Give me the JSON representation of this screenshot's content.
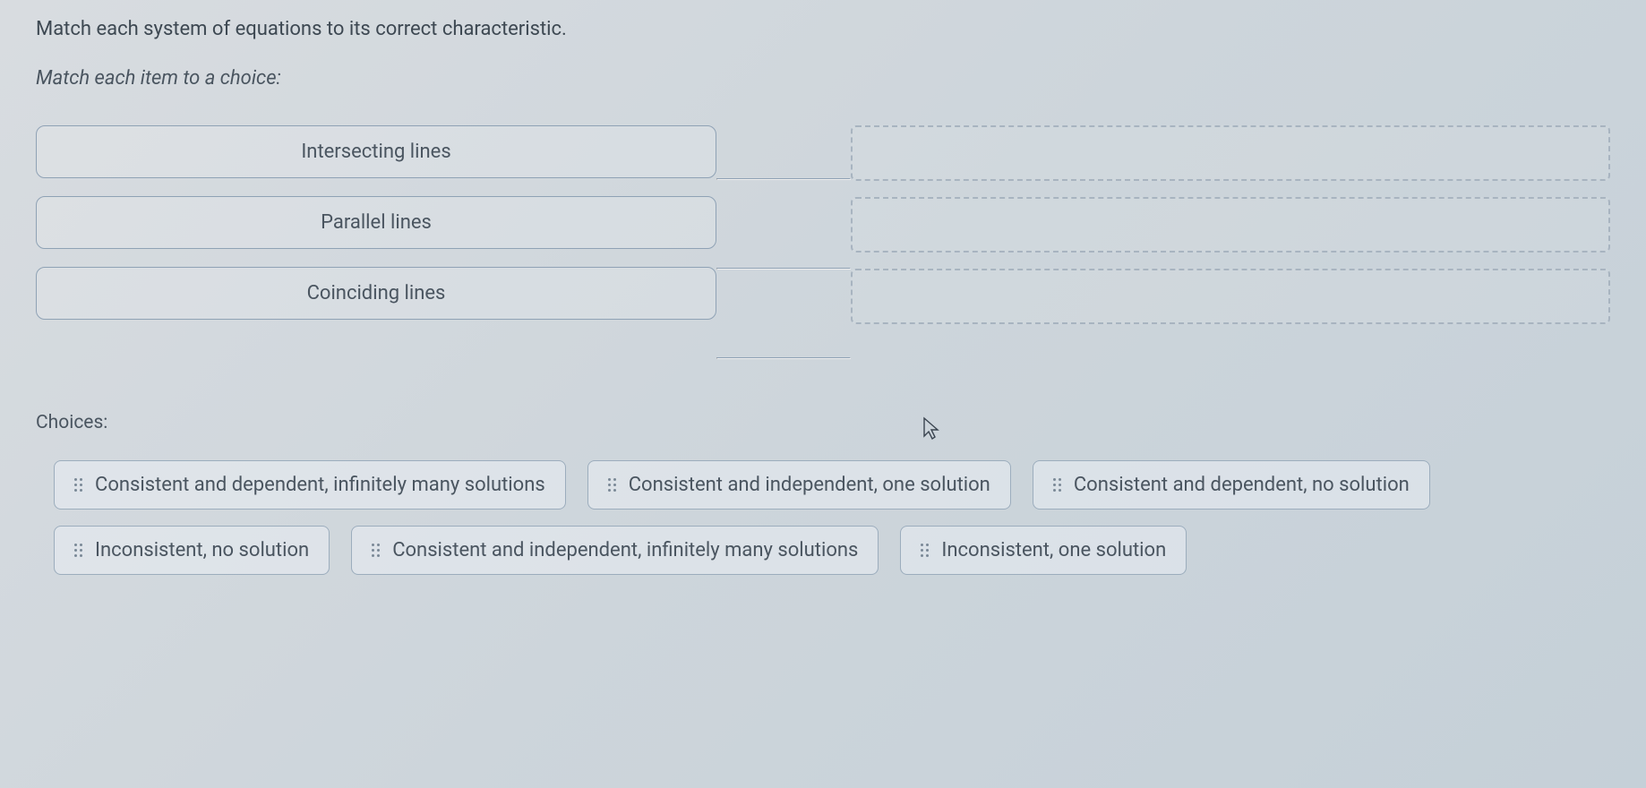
{
  "question": "Match each system of equations to its correct characteristic.",
  "instruction": "Match each item to a choice:",
  "items": [
    {
      "label": "Intersecting lines"
    },
    {
      "label": "Parallel lines"
    },
    {
      "label": "Coinciding lines"
    }
  ],
  "choices_label": "Choices:",
  "choices": [
    {
      "label": "Consistent and dependent, infinitely many solutions"
    },
    {
      "label": "Consistent and independent, one solution"
    },
    {
      "label": "Consistent and dependent, no solution"
    },
    {
      "label": "Inconsistent, no solution"
    },
    {
      "label": "Consistent and independent, infinitely many solutions"
    },
    {
      "label": "Inconsistent, one solution"
    }
  ]
}
